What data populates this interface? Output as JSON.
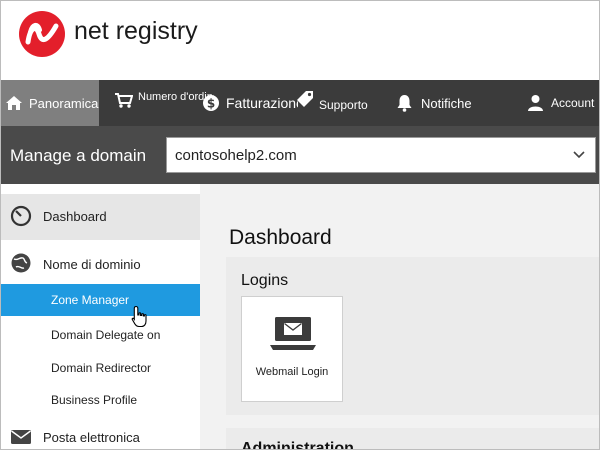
{
  "brand": {
    "name": "net registry",
    "logo_icon": "netregistry-logo",
    "logo_color": "#e31f2b"
  },
  "topnav": {
    "items": [
      {
        "label": "Panoramica",
        "icon": "home-icon",
        "active": true
      },
      {
        "label": "Numero d'ordine",
        "icon": "cart-icon"
      },
      {
        "label": "Fatturazione",
        "icon": "dollar-icon"
      },
      {
        "label": "Supporto",
        "icon": "tag-icon"
      },
      {
        "label": "Notifiche",
        "icon": "bell-icon"
      },
      {
        "label": "Account",
        "icon": "user-icon"
      }
    ]
  },
  "manage": {
    "label": "Manage a domain",
    "domain": "contosohelp2.com"
  },
  "sidebar": {
    "items": [
      {
        "label": "Dashboard",
        "icon": "speedometer-icon"
      },
      {
        "label": "Nome di dominio",
        "icon": "globe-icon"
      },
      {
        "label": "Zone Manager"
      },
      {
        "label": "Domain Delegate on"
      },
      {
        "label": "Domain Redirector"
      },
      {
        "label": "Business Profile"
      },
      {
        "label": "Posta elettronica",
        "icon": "mail-icon"
      }
    ]
  },
  "main": {
    "title": "Dashboard",
    "logins": {
      "title": "Logins",
      "tiles": [
        {
          "label": "Webmail Login",
          "icon": "laptop-mail-icon"
        }
      ]
    },
    "administration": {
      "title": "Administration"
    }
  },
  "colors": {
    "nav_bg": "#3b3b3b",
    "nav_active": "#7f7f7f",
    "manage_bg": "#4a4a4a",
    "accent": "#1f9ae0"
  }
}
